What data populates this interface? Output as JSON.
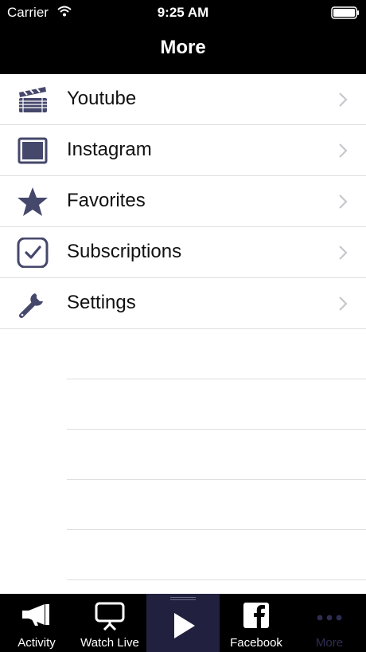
{
  "status": {
    "carrier": "Carrier",
    "time": "9:25 AM"
  },
  "nav": {
    "title": "More"
  },
  "menu": [
    {
      "label": "Youtube",
      "icon": "clapperboard-icon"
    },
    {
      "label": "Instagram",
      "icon": "frame-icon"
    },
    {
      "label": "Favorites",
      "icon": "star-icon"
    },
    {
      "label": "Subscriptions",
      "icon": "checkbox-icon"
    },
    {
      "label": "Settings",
      "icon": "wrench-icon"
    }
  ],
  "tabs": [
    {
      "label": "Activity",
      "icon": "megaphone-icon"
    },
    {
      "label": "Watch Live",
      "icon": "screen-icon"
    },
    {
      "label": "",
      "icon": "play-icon"
    },
    {
      "label": "Facebook",
      "icon": "facebook-icon"
    },
    {
      "label": "More",
      "icon": "more-dots-icon"
    }
  ],
  "colors": {
    "icon": "#45476b",
    "active_tab": "#21213f",
    "separator": "#dedee2"
  }
}
